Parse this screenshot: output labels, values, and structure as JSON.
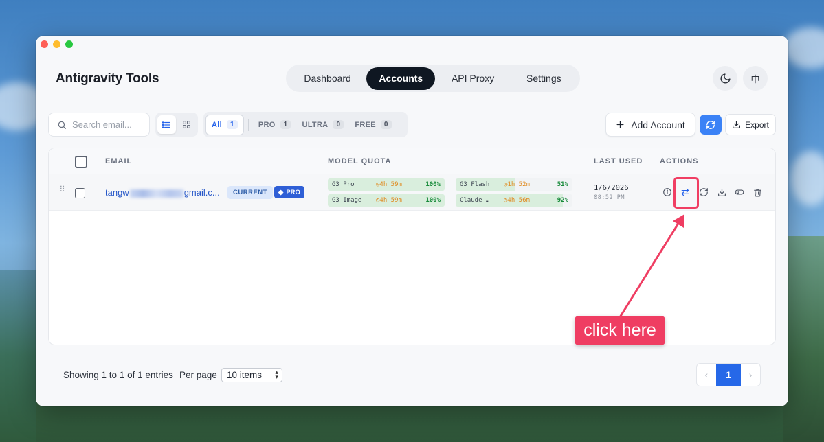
{
  "app": {
    "title": "Antigravity Tools"
  },
  "nav": {
    "tabs": [
      {
        "label": "Dashboard"
      },
      {
        "label": "Accounts",
        "active": true
      },
      {
        "label": "API Proxy"
      },
      {
        "label": "Settings"
      }
    ]
  },
  "header_buttons": {
    "theme_icon": "moon-icon",
    "lang_label": "中"
  },
  "toolbar": {
    "search_placeholder": "Search email...",
    "filters": [
      {
        "label": "All",
        "count": "1",
        "active": true
      },
      {
        "label": "PRO",
        "count": "1"
      },
      {
        "label": "ULTRA",
        "count": "0"
      },
      {
        "label": "FREE",
        "count": "0"
      }
    ],
    "add_label": "Add Account",
    "export_label": "Export"
  },
  "table": {
    "headers": {
      "email": "EMAIL",
      "quota": "MODEL QUOTA",
      "last_used": "LAST USED",
      "actions": "ACTIONS"
    },
    "rows": [
      {
        "email_prefix": "tangw",
        "email_suffix": "gmail.c...",
        "badge_current": "CURRENT",
        "badge_tier": "PRO",
        "quotas": [
          {
            "name": "G3 Pro",
            "time": "4h 59m",
            "pct": "100%",
            "fill": 1.0
          },
          {
            "name": "G3 Image",
            "time": "4h 59m",
            "pct": "100%",
            "fill": 1.0
          },
          {
            "name": "G3 Flash",
            "time": "1h 52m",
            "pct": "51%",
            "fill": 0.51
          },
          {
            "name": "Claude …",
            "time": "4h 56m",
            "pct": "92%",
            "fill": 0.92
          }
        ],
        "last_used_date": "1/6/2026",
        "last_used_time": "08:52 PM"
      }
    ]
  },
  "footer": {
    "showing": "Showing 1 to 1 of 1 entries",
    "per_page_label": "Per page",
    "per_page_value": "10 items",
    "current_page": "1"
  },
  "annotation": {
    "text": "click here",
    "color": "#ef3d62"
  }
}
